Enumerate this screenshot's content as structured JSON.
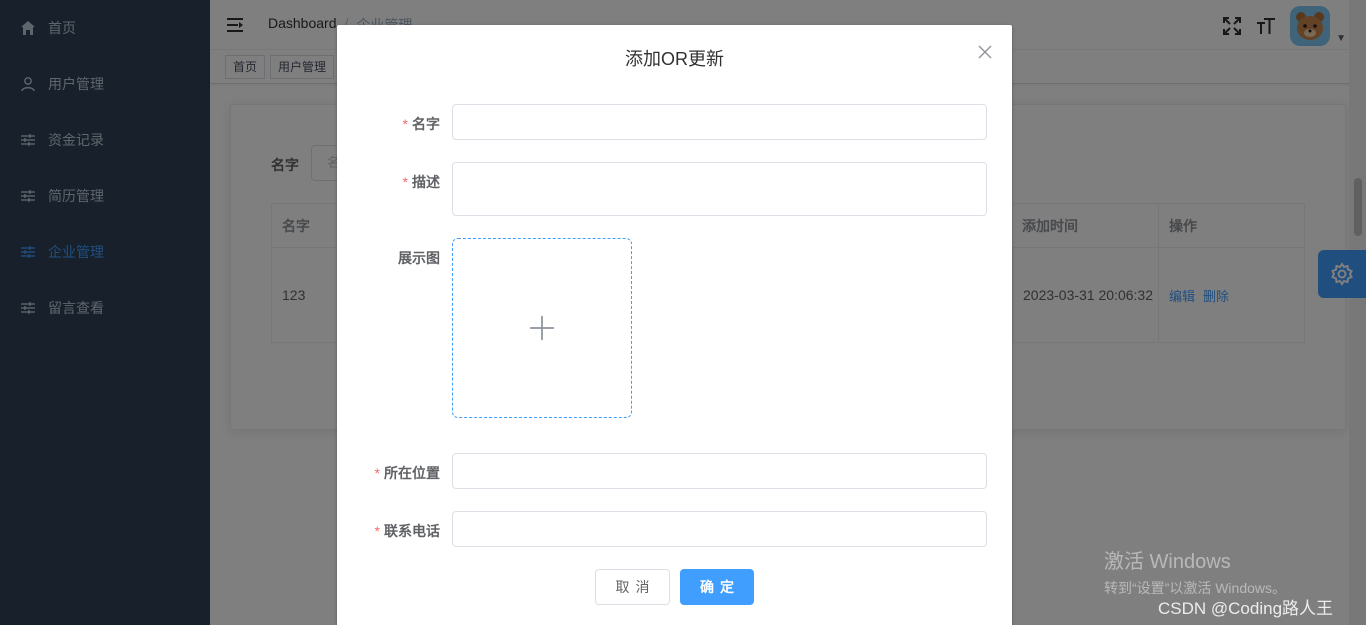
{
  "sidebar": {
    "items": [
      {
        "label": "首页",
        "icon": "home-icon"
      },
      {
        "label": "用户管理",
        "icon": "user-icon"
      },
      {
        "label": "资金记录",
        "icon": "sliders-icon"
      },
      {
        "label": "简历管理",
        "icon": "sliders-icon"
      },
      {
        "label": "企业管理",
        "icon": "sliders-icon",
        "active": true
      },
      {
        "label": "留言查看",
        "icon": "sliders-icon"
      }
    ]
  },
  "navbar": {
    "breadcrumb": [
      "Dashboard",
      "企业管理"
    ]
  },
  "tags": [
    "首页",
    "用户管理"
  ],
  "search": {
    "label": "名字",
    "placeholder": "名"
  },
  "table": {
    "headers": {
      "name": "名字",
      "time": "添加时间",
      "actions": "操作"
    },
    "row": {
      "name": "123",
      "time": "2023-03-31 20:06:32",
      "edit": "编辑",
      "delete": "删除"
    }
  },
  "dialog": {
    "title": "添加OR更新",
    "fields": {
      "name": "名字",
      "desc": "描述",
      "image": "展示图",
      "location": "所在位置",
      "phone": "联系电话"
    },
    "cancel": "取消",
    "confirm": "确定"
  },
  "watermark": {
    "title": "激活 Windows",
    "subtitle": "转到“设置”以激活 Windows。",
    "csdn": "CSDN @Coding路人王"
  },
  "colors": {
    "sidebar_bg": "#304156",
    "primary": "#409eff",
    "required": "#f56c6c"
  }
}
